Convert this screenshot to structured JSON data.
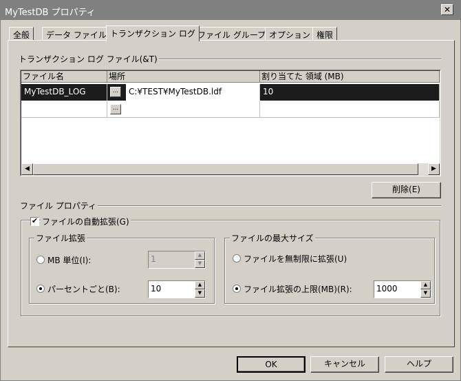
{
  "window": {
    "title": "MyTestDB プロパティ",
    "close_glyph": "✕"
  },
  "tabs": [
    {
      "label": "全般"
    },
    {
      "label": "データ ファイル"
    },
    {
      "label": "トランザクション ログ"
    },
    {
      "label": "ファイル グループ"
    },
    {
      "label": "オプション"
    },
    {
      "label": "権限"
    }
  ],
  "log_files": {
    "group_label": "トランザクション ログ ファイル(&T)",
    "columns": [
      "ファイル名",
      "場所",
      "割り当てた 領域 (MB)"
    ],
    "rows": [
      {
        "name": "MyTestDB_LOG",
        "location": "C:¥TEST¥MyTestDB.ldf",
        "size": "10"
      },
      {
        "name": "",
        "location": "",
        "size": ""
      }
    ],
    "browse_label": "...",
    "delete_button": "削除(E)"
  },
  "file_properties": {
    "group_label": "ファイル プロパティ",
    "autogrow_label": "ファイルの自動拡張(G)",
    "autogrow_checked": true,
    "growth": {
      "group_label": "ファイル拡張",
      "mb_label": "MB 単位(I):",
      "mb_value": "1",
      "percent_label": "パーセントごと(B):",
      "percent_value": "10",
      "selected": "percent"
    },
    "max_size": {
      "group_label": "ファイルの最大サイズ",
      "unlimited_label": "ファイルを無制限に拡張(U)",
      "limited_label": "ファイル拡張の上限(MB)(R):",
      "limited_value": "1000",
      "selected": "limited"
    }
  },
  "footer": {
    "ok": "OK",
    "cancel": "キャンセル",
    "help": "ヘルプ"
  },
  "colors": {
    "selected_row": "#1c1c1c",
    "titlebar": "#808080",
    "face": "#d4d0c8"
  }
}
